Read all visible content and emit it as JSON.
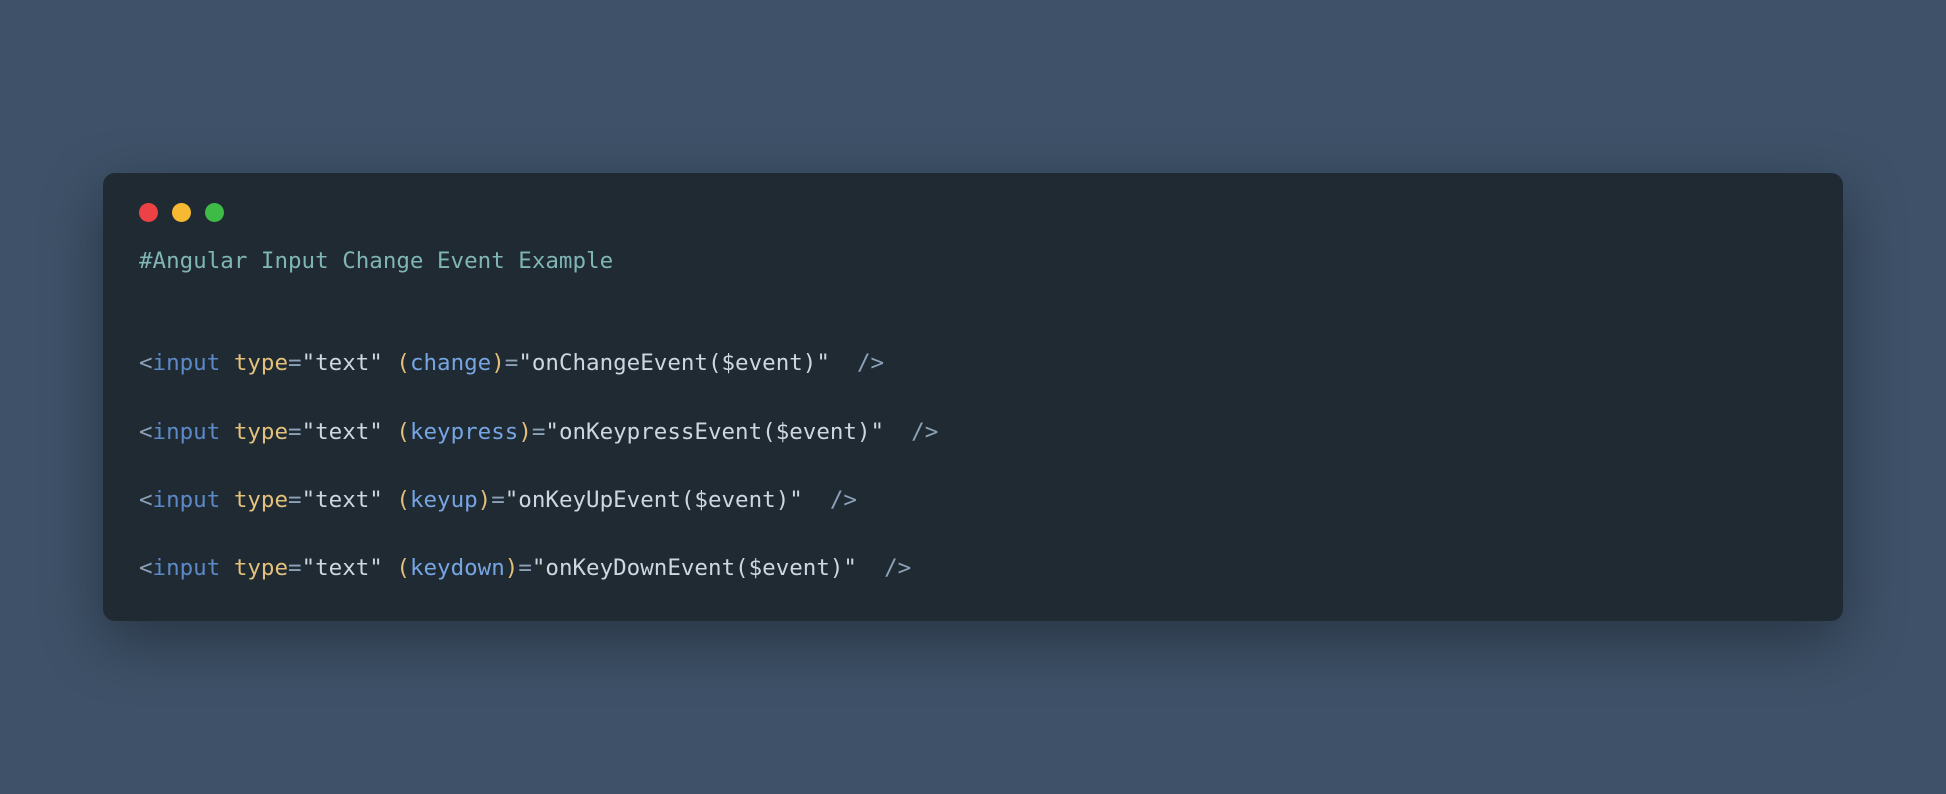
{
  "window": {
    "traffic": {
      "red": "#ed4245",
      "yellow": "#f7b931",
      "green": "#3ebb46"
    }
  },
  "code": {
    "comment": "#Angular Input Change Event Example",
    "lines": [
      {
        "tag": "input",
        "attr": "type",
        "attrValue": "\"text\"",
        "event": "change",
        "handler": "\"onChangeEvent($event)\""
      },
      {
        "tag": "input",
        "attr": "type",
        "attrValue": "\"text\"",
        "event": "keypress",
        "handler": "\"onKeypressEvent($event)\""
      },
      {
        "tag": "input",
        "attr": "type",
        "attrValue": "\"text\"",
        "event": "keyup",
        "handler": "\"onKeyUpEvent($event)\""
      },
      {
        "tag": "input",
        "attr": "type",
        "attrValue": "\"text\"",
        "event": "keydown",
        "handler": "\"onKeyDownEvent($event)\""
      }
    ]
  }
}
